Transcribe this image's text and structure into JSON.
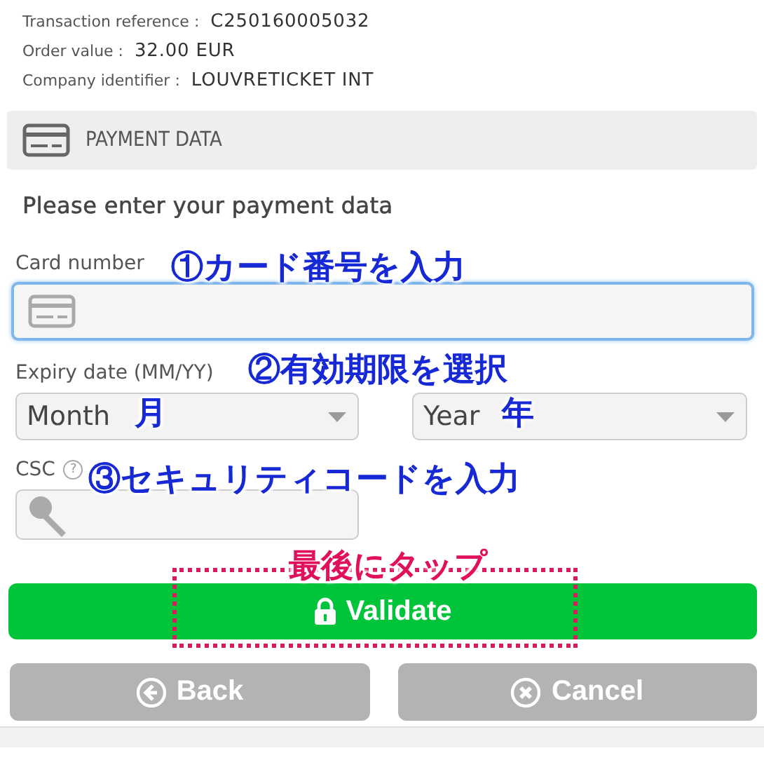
{
  "details": [
    {
      "label": "Transaction reference :",
      "value": "C250160005032"
    },
    {
      "label": "Order value :",
      "value": "32.00 EUR"
    },
    {
      "label": "Company identifier :",
      "value": "LOUVRETICKET INT"
    }
  ],
  "section": {
    "title": "PAYMENT DATA"
  },
  "instruction": "Please enter your payment data",
  "card": {
    "label": "Card number",
    "focused": true
  },
  "expiry": {
    "label": "Expiry date (MM/YY)",
    "selects": [
      {
        "placeholder": "Month"
      },
      {
        "placeholder": "Year"
      }
    ]
  },
  "csc": {
    "label": "CSC",
    "help": "?"
  },
  "buttons": [
    {
      "kind": "validate",
      "label": "Validate"
    },
    {
      "kind": "back",
      "label": "Back"
    },
    {
      "kind": "cancel",
      "label": "Cancel"
    }
  ],
  "annotations": [
    {
      "kind": "callout",
      "text": "①カード番号を入力"
    },
    {
      "kind": "callout",
      "text": "②有効期限を選択"
    },
    {
      "kind": "callout",
      "text": "月"
    },
    {
      "kind": "callout",
      "text": "年"
    },
    {
      "kind": "callout",
      "text": "③セキュリティコードを入力"
    },
    {
      "kind": "tap",
      "text": "最後にタップ"
    }
  ]
}
